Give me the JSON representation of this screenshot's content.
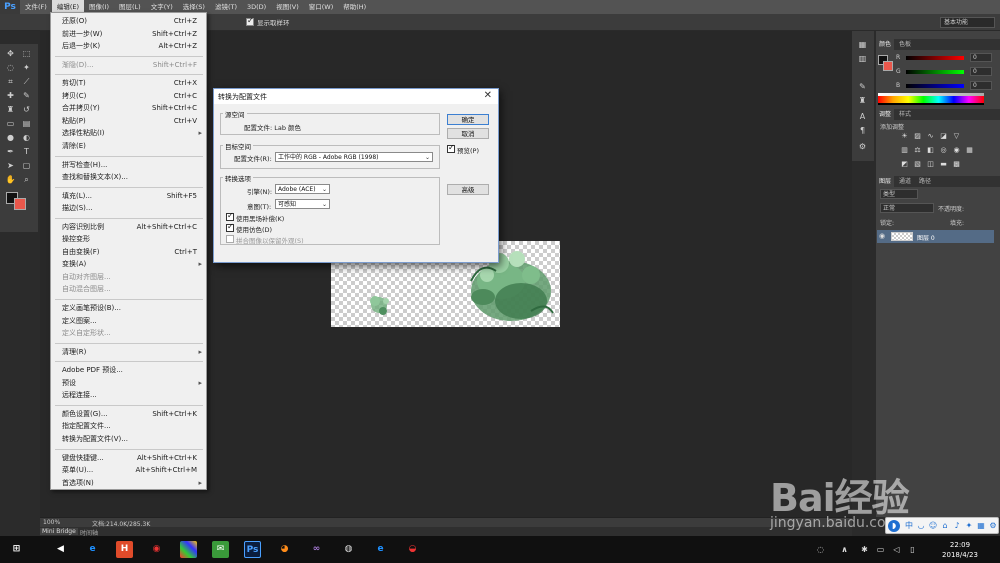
{
  "app": {
    "logo": "Ps"
  },
  "menubar": {
    "items": [
      "文件(F)",
      "编辑(E)",
      "图像(I)",
      "图层(L)",
      "文字(Y)",
      "选择(S)",
      "滤镜(T)",
      "3D(D)",
      "视图(V)",
      "窗口(W)",
      "帮助(H)"
    ],
    "active_index": 1
  },
  "optbar": {
    "show_ring_label": "显示取样环",
    "workspace": "基本功能"
  },
  "edit_menu": {
    "items": [
      {
        "label": "还原(O)",
        "shortcut": "Ctrl+Z",
        "disabled": false
      },
      {
        "label": "前进一步(W)",
        "shortcut": "Shift+Ctrl+Z",
        "disabled": false
      },
      {
        "label": "后退一步(K)",
        "shortcut": "Alt+Ctrl+Z",
        "disabled": false
      },
      {
        "sep": true
      },
      {
        "label": "渐隐(D)...",
        "shortcut": "Shift+Ctrl+F",
        "disabled": true
      },
      {
        "sep": true
      },
      {
        "label": "剪切(T)",
        "shortcut": "Ctrl+X",
        "disabled": false
      },
      {
        "label": "拷贝(C)",
        "shortcut": "Ctrl+C",
        "disabled": false
      },
      {
        "label": "合并拷贝(Y)",
        "shortcut": "Shift+Ctrl+C",
        "disabled": false
      },
      {
        "label": "粘贴(P)",
        "shortcut": "Ctrl+V",
        "disabled": false
      },
      {
        "label": "选择性粘贴(I)",
        "shortcut": "",
        "disabled": false,
        "submenu": true
      },
      {
        "label": "清除(E)",
        "shortcut": "",
        "disabled": false
      },
      {
        "sep": true
      },
      {
        "label": "拼写检查(H)...",
        "shortcut": "",
        "disabled": false
      },
      {
        "label": "查找和替换文本(X)...",
        "shortcut": "",
        "disabled": false
      },
      {
        "sep": true
      },
      {
        "label": "填充(L)...",
        "shortcut": "Shift+F5",
        "disabled": false
      },
      {
        "label": "描边(S)...",
        "shortcut": "",
        "disabled": false
      },
      {
        "sep": true
      },
      {
        "label": "内容识别比例",
        "shortcut": "Alt+Shift+Ctrl+C",
        "disabled": false
      },
      {
        "label": "操控变形",
        "shortcut": "",
        "disabled": false
      },
      {
        "label": "自由变换(F)",
        "shortcut": "Ctrl+T",
        "disabled": false
      },
      {
        "label": "变换(A)",
        "shortcut": "",
        "disabled": false,
        "submenu": true
      },
      {
        "label": "自动对齐图层...",
        "shortcut": "",
        "disabled": true
      },
      {
        "label": "自动混合图层...",
        "shortcut": "",
        "disabled": true
      },
      {
        "sep": true
      },
      {
        "label": "定义画笔预设(B)...",
        "shortcut": "",
        "disabled": false
      },
      {
        "label": "定义图案...",
        "shortcut": "",
        "disabled": false
      },
      {
        "label": "定义自定形状...",
        "shortcut": "",
        "disabled": true
      },
      {
        "sep": true
      },
      {
        "label": "清理(R)",
        "shortcut": "",
        "disabled": false,
        "submenu": true
      },
      {
        "sep": true
      },
      {
        "label": "Adobe PDF 预设...",
        "shortcut": "",
        "disabled": false
      },
      {
        "label": "预设",
        "shortcut": "",
        "disabled": false,
        "submenu": true
      },
      {
        "label": "远程连接...",
        "shortcut": "",
        "disabled": false
      },
      {
        "sep": true
      },
      {
        "label": "颜色设置(G)...",
        "shortcut": "Shift+Ctrl+K",
        "disabled": false
      },
      {
        "label": "指定配置文件...",
        "shortcut": "",
        "disabled": false
      },
      {
        "label": "转换为配置文件(V)...",
        "shortcut": "",
        "disabled": false
      },
      {
        "sep": true
      },
      {
        "label": "键盘快捷键...",
        "shortcut": "Alt+Shift+Ctrl+K",
        "disabled": false
      },
      {
        "label": "菜单(U)...",
        "shortcut": "Alt+Shift+Ctrl+M",
        "disabled": false
      },
      {
        "label": "首选项(N)",
        "shortcut": "",
        "disabled": false,
        "submenu": true
      }
    ]
  },
  "dialog": {
    "title": "转换为配置文件",
    "source_group": "源空间",
    "source_profile": "配置文件: Lab 颜色",
    "dest_group": "目标空间",
    "dest_label": "配置文件(R):",
    "dest_value": "工作中的 RGB - Adobe RGB (1998)",
    "options_group": "转换选项",
    "engine_label": "引擎(N):",
    "engine_value": "Adobe (ACE)",
    "intent_label": "意图(T):",
    "intent_value": "可感知",
    "bpc_label": "使用黑场补偿(K)",
    "dither_label": "使用仿色(D)",
    "flatten_label": "拼合图像以保留外观(S)",
    "ok": "确定",
    "cancel": "取消",
    "preview": "预览(P)",
    "advanced": "高级"
  },
  "color_panel": {
    "tabs": [
      "颜色",
      "色板"
    ],
    "r": "R",
    "g": "G",
    "b": "B",
    "r_val": "0",
    "g_val": "0",
    "b_val": "0"
  },
  "adjust_panel": {
    "tabs": [
      "调整",
      "样式"
    ],
    "title": "添加调整"
  },
  "layers_panel": {
    "tabs": [
      "图层",
      "通道",
      "路径"
    ],
    "kind": "类型",
    "blend": "正常",
    "opacity_label": "不透明度:",
    "lock_label": "锁定:",
    "fill_label": "填充:",
    "layer_name": "图层 0"
  },
  "status": {
    "zoom": "100%",
    "doc": "文档:214.0K/285.3K"
  },
  "bridge": {
    "tabs": [
      "Mini Bridge",
      "时间轴"
    ]
  },
  "clock": {
    "time": "22:09",
    "date": "2018/4/23"
  },
  "watermark": {
    "brand": "Bai经验",
    "url": "jingyan.baidu.com"
  },
  "colors": {
    "accent": "#3c7fd1",
    "bg_swatch": "#e9574b",
    "layer_sel": "#546b86"
  }
}
